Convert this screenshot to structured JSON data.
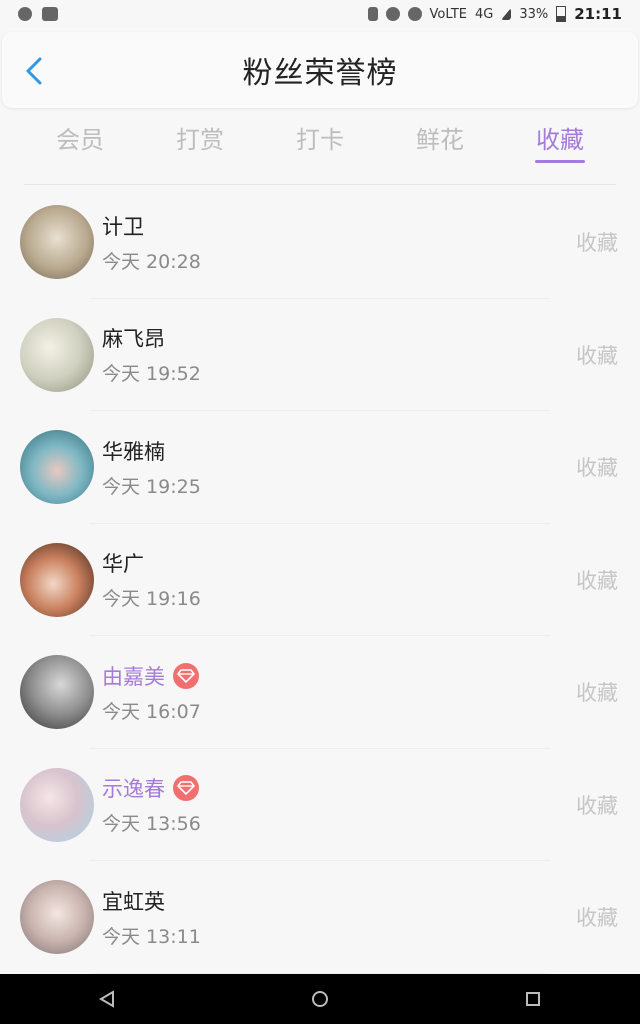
{
  "status_bar": {
    "battery": "33%",
    "network": "4G",
    "volte": "VoLTE",
    "time": "21:11"
  },
  "header": {
    "title": "粉丝荣誉榜"
  },
  "tabs": [
    {
      "label": "会员",
      "active": false
    },
    {
      "label": "打赏",
      "active": false
    },
    {
      "label": "打卡",
      "active": false
    },
    {
      "label": "鲜花",
      "active": false
    },
    {
      "label": "收藏",
      "active": true
    }
  ],
  "accent_color": "#a57bd9",
  "vip_badge_color": "#f26f6f",
  "list": [
    {
      "name": "计卫",
      "time": "今天 20:28",
      "action": "收藏",
      "vip": false
    },
    {
      "name": "麻飞昂",
      "time": "今天 19:52",
      "action": "收藏",
      "vip": false
    },
    {
      "name": "华雅楠",
      "time": "今天 19:25",
      "action": "收藏",
      "vip": false
    },
    {
      "name": "华广",
      "time": "今天 19:16",
      "action": "收藏",
      "vip": false
    },
    {
      "name": "由嘉美",
      "time": "今天 16:07",
      "action": "收藏",
      "vip": true
    },
    {
      "name": "示逸春",
      "time": "今天 13:56",
      "action": "收藏",
      "vip": true
    },
    {
      "name": "宜虹英",
      "time": "今天 13:11",
      "action": "收藏",
      "vip": false
    }
  ]
}
